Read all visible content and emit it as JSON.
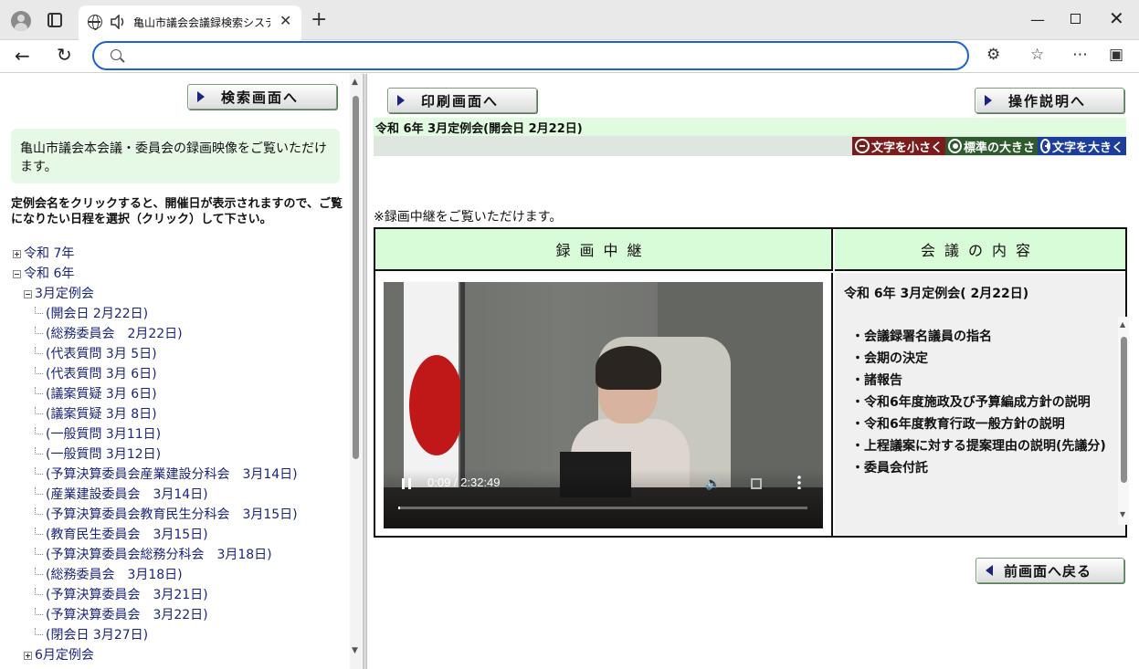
{
  "browser": {
    "tab_title": "亀山市議会会議録検索システム",
    "tab_close": "✕",
    "new_tab": "+",
    "address_placeholder": "",
    "minimize": "—",
    "close": "✕"
  },
  "left": {
    "search_button": "検索画面へ",
    "intro_text": "亀山市議会本会議・委員会の録画映像をご覧いただけます。",
    "instructions": "定例会名をクリックすると、開催日が表示されますので、ご覧になりたい日程を選択（クリック）して下さい。",
    "tree": [
      {
        "label": "令和 7年",
        "kind": "plus",
        "indent": 0
      },
      {
        "label": "令和 6年",
        "kind": "minus",
        "indent": 0
      },
      {
        "label": "3月定例会",
        "kind": "minus",
        "indent": 1
      },
      {
        "label": "(開会日 2月22日)",
        "kind": "leaf",
        "indent": 2
      },
      {
        "label": "(総務委員会　2月22日)",
        "kind": "leaf",
        "indent": 2
      },
      {
        "label": "(代表質問 3月 5日)",
        "kind": "leaf",
        "indent": 2
      },
      {
        "label": "(代表質問 3月 6日)",
        "kind": "leaf",
        "indent": 2
      },
      {
        "label": "(議案質疑 3月 6日)",
        "kind": "leaf",
        "indent": 2
      },
      {
        "label": "(議案質疑 3月 8日)",
        "kind": "leaf",
        "indent": 2
      },
      {
        "label": "(一般質問 3月11日)",
        "kind": "leaf",
        "indent": 2
      },
      {
        "label": "(一般質問 3月12日)",
        "kind": "leaf",
        "indent": 2
      },
      {
        "label": "(予算決算委員会産業建設分科会　3月14日)",
        "kind": "leaf",
        "indent": 2
      },
      {
        "label": "(産業建設委員会　3月14日)",
        "kind": "leaf",
        "indent": 2
      },
      {
        "label": "(予算決算委員会教育民生分科会　3月15日)",
        "kind": "leaf",
        "indent": 2
      },
      {
        "label": "(教育民生委員会　3月15日)",
        "kind": "leaf",
        "indent": 2
      },
      {
        "label": "(予算決算委員会総務分科会　3月18日)",
        "kind": "leaf",
        "indent": 2
      },
      {
        "label": "(総務委員会　3月18日)",
        "kind": "leaf",
        "indent": 2
      },
      {
        "label": "(予算決算委員会　3月21日)",
        "kind": "leaf",
        "indent": 2
      },
      {
        "label": "(予算決算委員会　3月22日)",
        "kind": "leaf",
        "indent": 2
      },
      {
        "label": "(閉会日 3月27日)",
        "kind": "leaf",
        "indent": 2
      },
      {
        "label": "6月定例会",
        "kind": "plus",
        "indent": 1
      }
    ]
  },
  "right": {
    "print_button": "印刷画面へ",
    "help_button": "操作説明へ",
    "session_line": "令和 6年 3月定例会(開会日 2月22日)",
    "font_small": "文字を小さく",
    "font_normal": "標準の大きさ",
    "font_large": "文字を大きく",
    "notice": "※録画中継をご覧いただけます。",
    "col_video": "録画中継",
    "col_content": "会議の内容",
    "video": {
      "time": "0:09 / 2:32:49",
      "progress": 0.001
    },
    "meeting_title": "令和 6年 3月定例会( 2月22日)",
    "agenda": [
      "会議録署名議員の指名",
      "会期の決定",
      "諸報告",
      "令和6年度施政及び予算編成方針の説明",
      "令和6年度教育行政一般方針の説明",
      "上程議案に対する提案理由の説明(先議分)",
      "委員会付託"
    ],
    "back_button": "前画面へ戻る"
  }
}
